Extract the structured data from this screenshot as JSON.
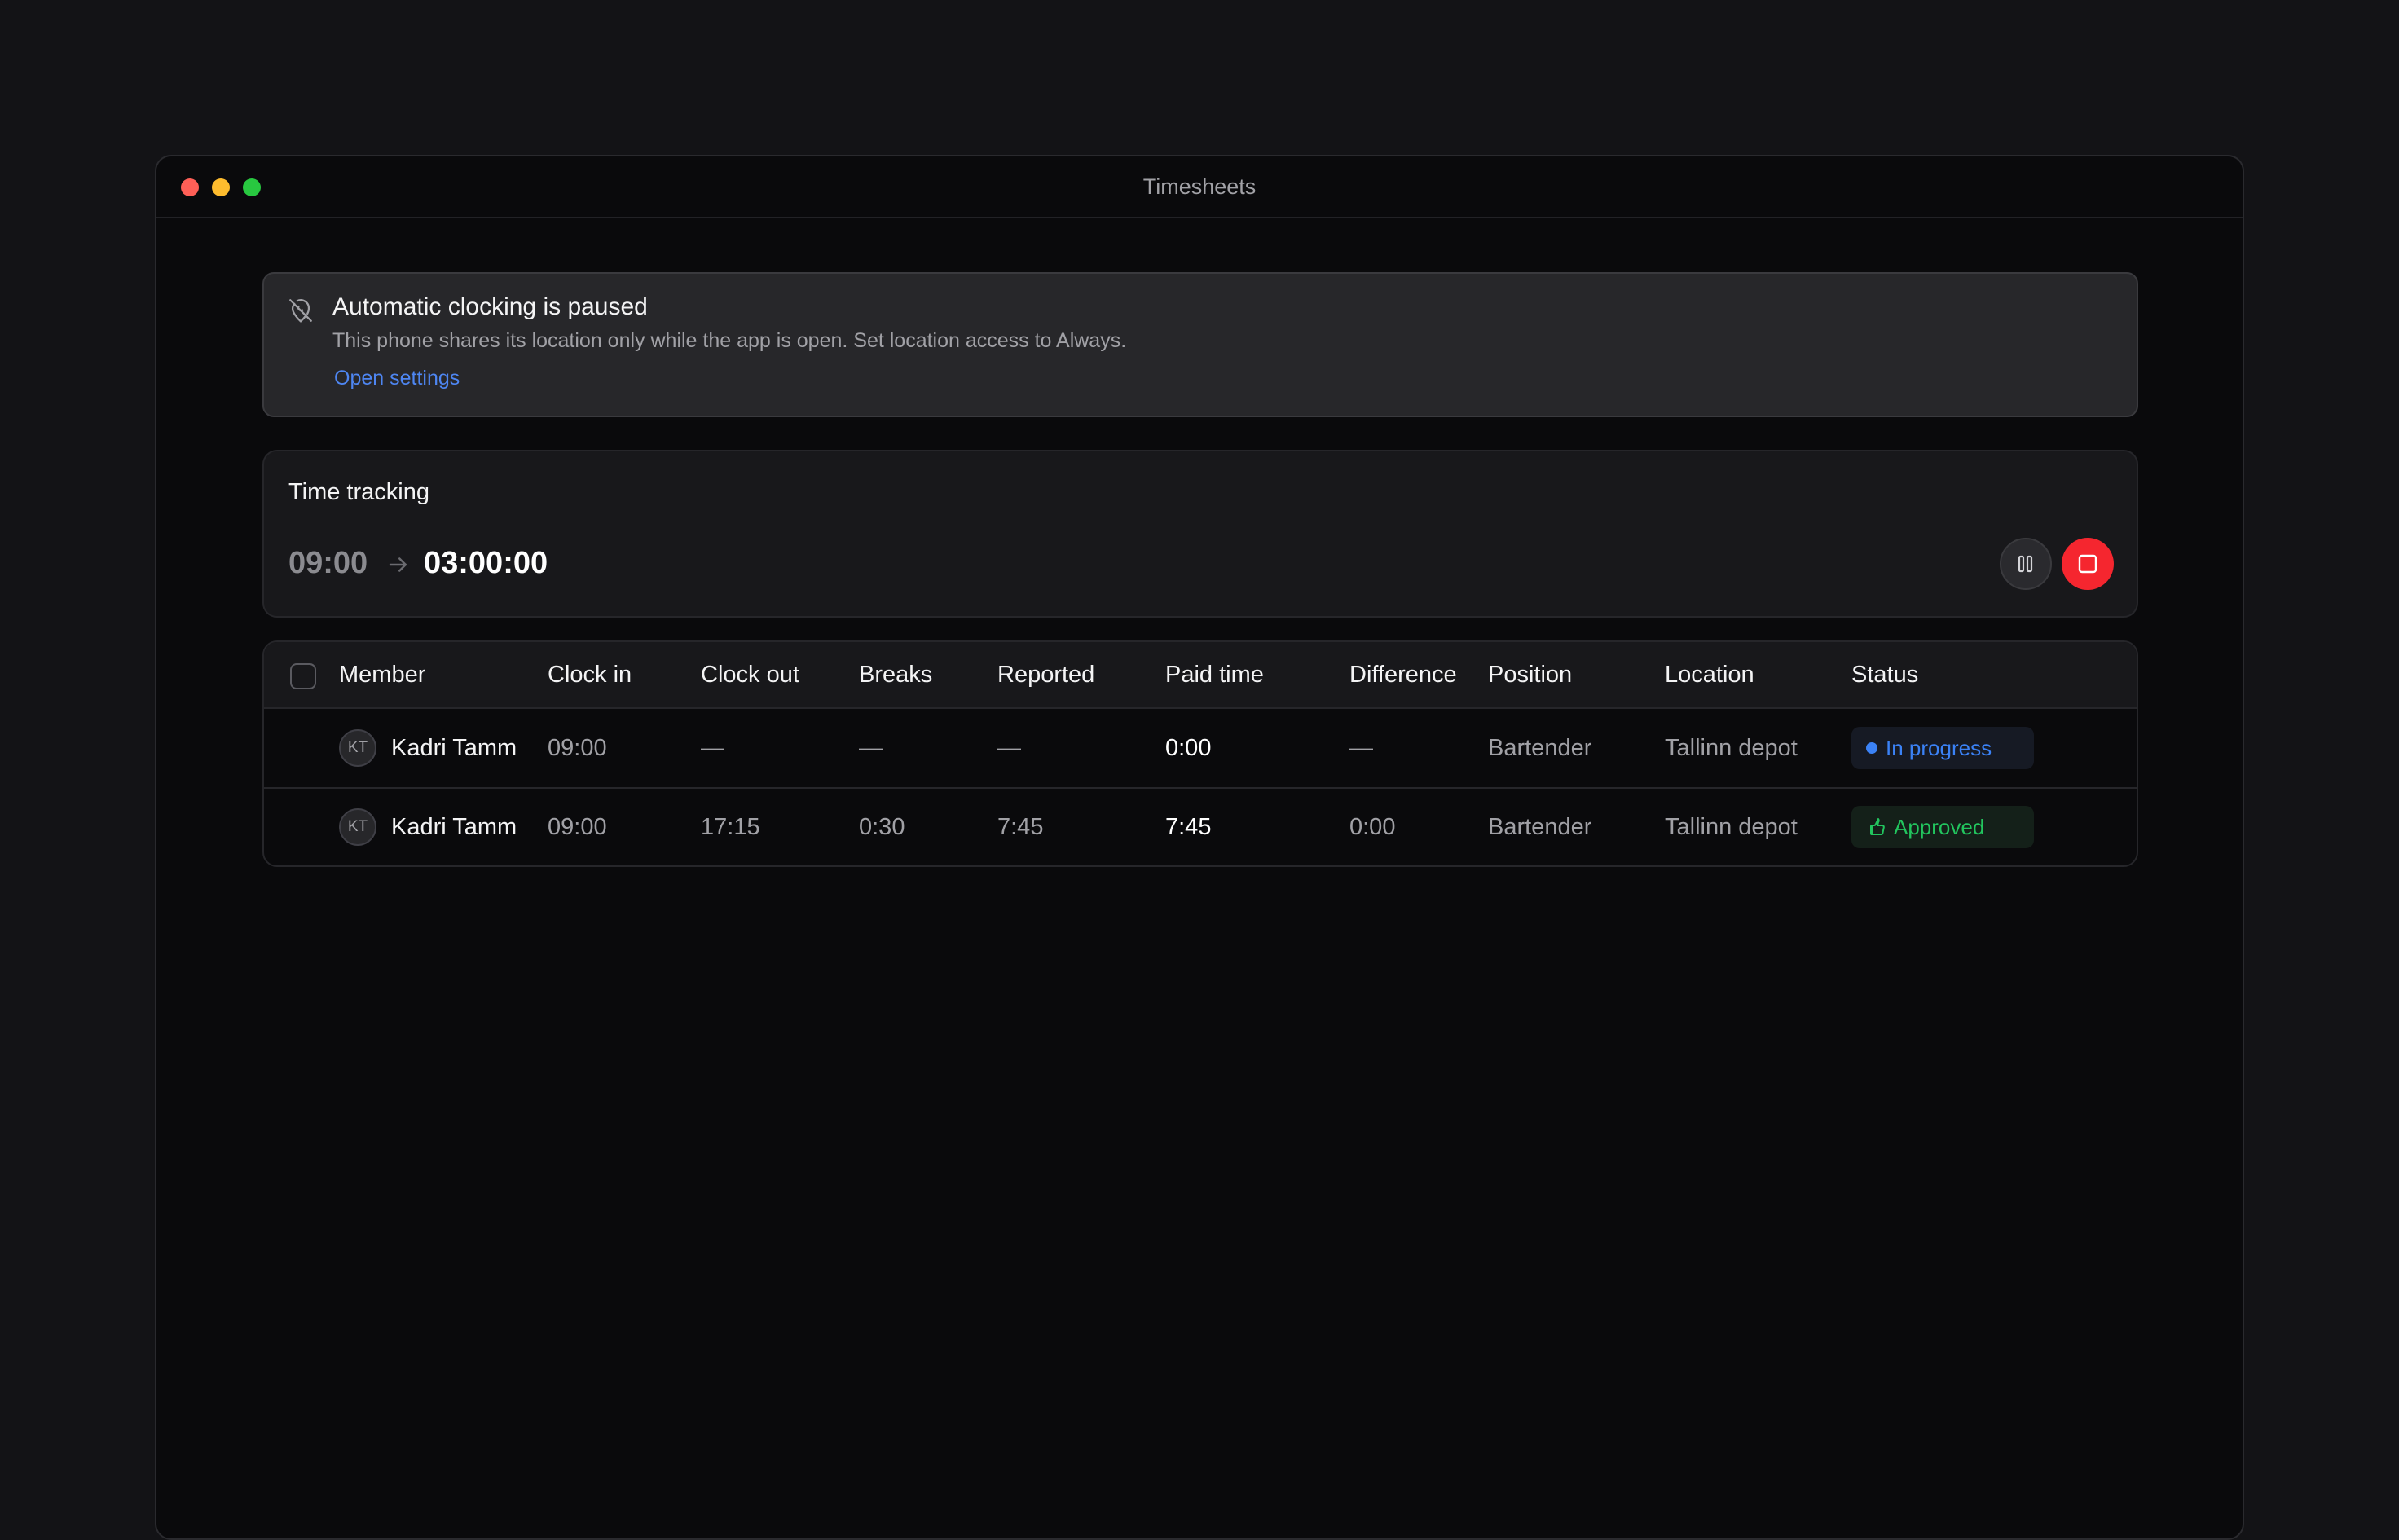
{
  "window": {
    "title": "Timesheets"
  },
  "alert": {
    "icon": "location-off-icon",
    "title": "Automatic clocking is paused",
    "description": "This phone shares its location only while the app is open. Set location access to Always.",
    "link": "Open settings"
  },
  "tracking": {
    "title": "Time tracking",
    "start": "09:00",
    "elapsed": "03:00:00",
    "pause_icon": "pause-icon",
    "stop_icon": "stop-icon"
  },
  "table": {
    "columns": [
      "Member",
      "Clock in",
      "Clock out",
      "Breaks",
      "Reported",
      "Paid time",
      "Difference",
      "Position",
      "Location",
      "Status"
    ],
    "rows": [
      {
        "initials": "KT",
        "member": "Kadri Tamm",
        "clock_in": "09:00",
        "clock_out": "—",
        "breaks": "—",
        "reported": "—",
        "paid_time": "0:00",
        "difference": "—",
        "position": "Bartender",
        "location": "Tallinn depot",
        "status": "In progress",
        "status_color": "#3b82f6"
      },
      {
        "initials": "KT",
        "member": "Kadri Tamm",
        "clock_in": "09:00",
        "clock_out": "17:15",
        "breaks": "0:30",
        "reported": "7:45",
        "paid_time": "7:45",
        "difference": "0:00",
        "position": "Bartender",
        "location": "Tallinn depot",
        "status": "Approved",
        "status_color": "#22c55e"
      }
    ]
  },
  "colors": {
    "accent": "#4e86f2",
    "danger": "#f5262f",
    "success": "#22c55e",
    "info": "#3b82f6"
  }
}
